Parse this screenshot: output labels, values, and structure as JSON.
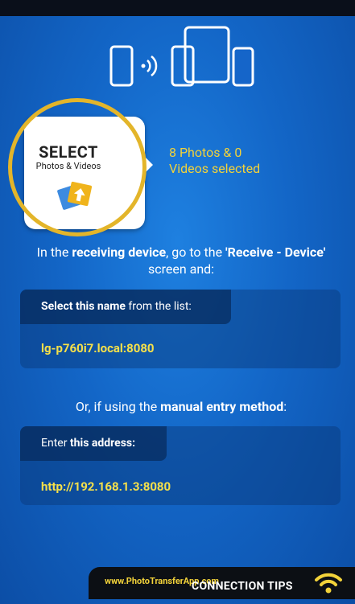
{
  "select_card": {
    "title": "SELECT",
    "subtitle": "Photos & Videos"
  },
  "selection_status": {
    "line1": "8 Photos & 0",
    "line2": "Videos selected"
  },
  "instruction": {
    "part1": "In the ",
    "bold1": "receiving device",
    "part2": ", go to the ",
    "bold2": "'Receive - Device'",
    "part3": " screen and:"
  },
  "name_panel": {
    "label_bold": "Select this name",
    "label_rest": " from the list:",
    "value": "lg-p760i7.local:8080"
  },
  "manual_instruction": {
    "part1": "Or, if using the ",
    "bold": "manual entry method",
    "part2": ":"
  },
  "address_panel": {
    "label_pre": "Enter ",
    "label_bold": "this address:",
    "value": "http://192.168.1.3:8080"
  },
  "footer": {
    "url": "www.PhotoTransferApp.com",
    "tips_label": "CONNECTION TIPS"
  },
  "colors": {
    "accent": "#e3b52a",
    "highlight_text": "#f2d23a",
    "background": "#1366c7"
  }
}
